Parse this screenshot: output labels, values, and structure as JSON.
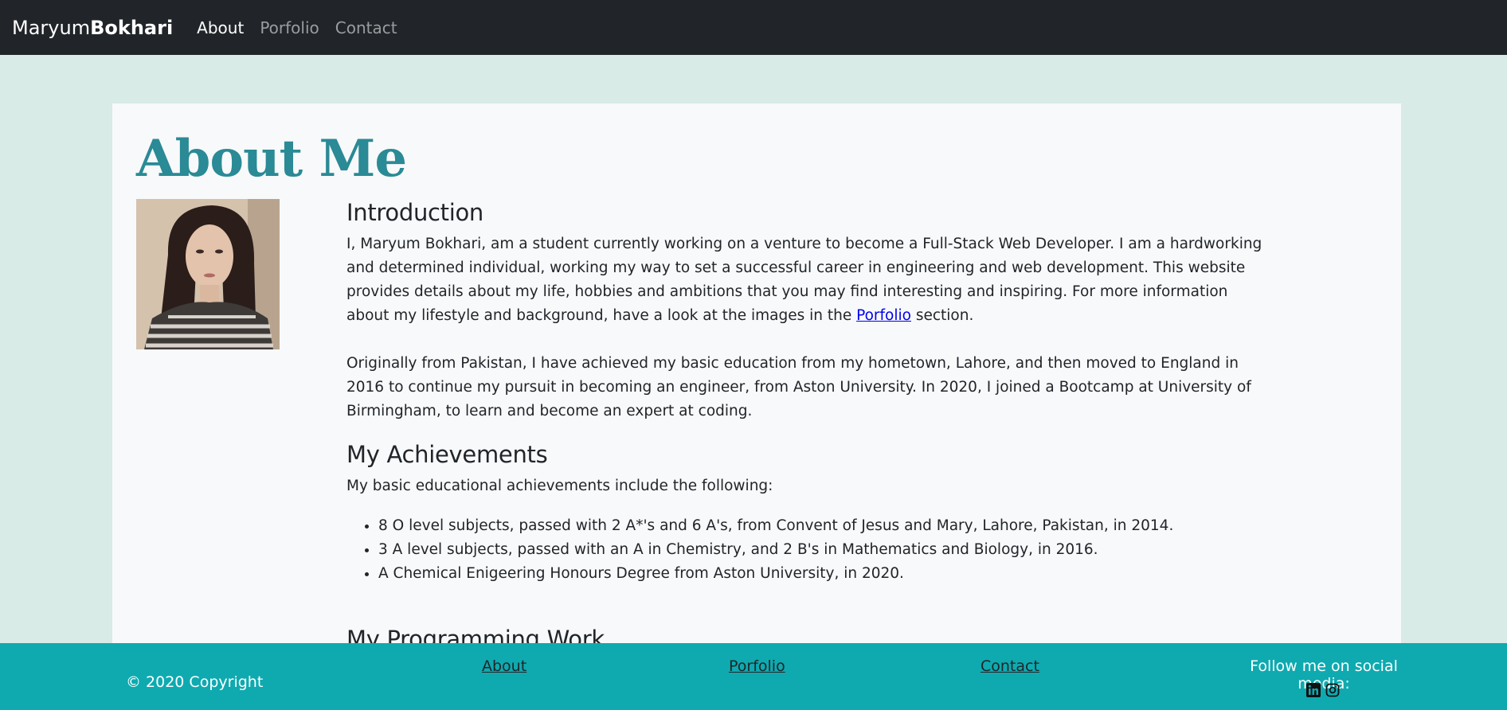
{
  "nav": {
    "brand_first": "Maryum",
    "brand_bold": "Bokhari",
    "items": [
      {
        "label": "About"
      },
      {
        "label": "Porfolio"
      },
      {
        "label": "Contact"
      }
    ]
  },
  "main": {
    "title": "About Me",
    "intro_heading": "Introduction",
    "intro_p1_before": "I, Maryum Bokhari, am a student currently working on a venture to become a Full-Stack Web Developer. I am a hardworking and determined individual, working my way to set a successful career in engineering and web development. This website provides details about my life, hobbies and ambitions that you may find interesting and inspiring. For more information about my lifestyle and background, have a look at the images in the ",
    "intro_p1_link": "Porfolio",
    "intro_p1_after": " section.",
    "intro_p2": "Originally from Pakistan, I have achieved my basic education from my hometown, Lahore, and then moved to England in 2016 to continue my pursuit in becoming an engineer, from Aston University. In 2020, I joined a Bootcamp at University of Birmingham, to learn and become an expert at coding.",
    "achievements_heading": "My Achievements",
    "achievements_intro": "My basic educational achievements include the following:",
    "achievements": [
      "8 O level subjects, passed with 2 A*'s and 6 A's, from Convent of Jesus and Mary, Lahore, Pakistan, in 2014.",
      "3 A level subjects, passed with an A in Chemistry, and 2 B's in Mathematics and Biology, in 2016.",
      "A Chemical Enigeering Honours Degree from Aston University, in 2020."
    ],
    "programming_heading": "My Programming Work"
  },
  "footer": {
    "copyright": "© 2020 Copyright",
    "links": [
      {
        "label": "About"
      },
      {
        "label": "Porfolio"
      },
      {
        "label": "Contact"
      }
    ],
    "social_label": "Follow me on social media:",
    "icons": [
      "linkedin-icon",
      "instagram-icon"
    ]
  },
  "colors": {
    "navbar_bg": "#212529",
    "page_bg": "#d8ebe6",
    "card_bg": "#f8f9fa",
    "title_color": "#2a8a96",
    "footer_bg": "#0eaab0"
  }
}
